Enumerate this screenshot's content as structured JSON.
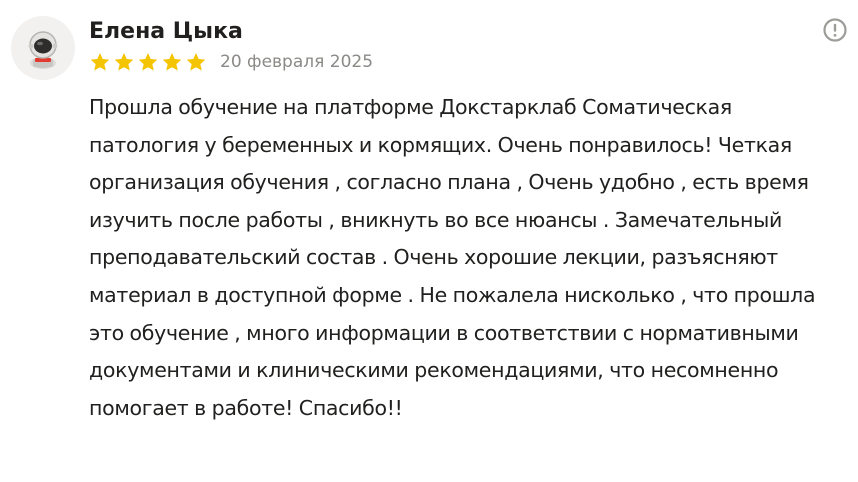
{
  "review": {
    "author_name": "Елена Цыка",
    "rating": 5,
    "rating_max": 5,
    "date": "20 февраля 2025",
    "text": "Прошла обучение на платформе Докстарклаб Соматическая патология у беременных и кормящих. Очень понравилось! Четкая организация обучения , согласно плана , Очень удобно , есть время изучить после работы , вникнуть во все нюансы . Замечательный преподавательский состав . Очень хорошие лекции, разъясняют материал в доступной форме . Не пожалела нисколько , что прошла это обучение , много информации в соответствии с нормативными документами и клиническими рекомендациями, что несомненно помогает в работе! Спасибо!!"
  },
  "icons": {
    "avatar": "astronaut-avatar-icon",
    "star": "star-icon",
    "report": "exclamation-circle-icon"
  },
  "colors": {
    "star": "#f5c400",
    "date": "#8b8a87",
    "text": "#21201f",
    "report_icon": "#9d9c99",
    "avatar_bg": "#f2f1f0"
  }
}
